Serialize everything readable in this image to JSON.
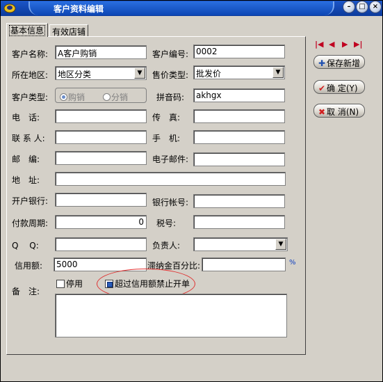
{
  "window": {
    "title": "客户资料编辑",
    "controls": {
      "minimize": "–",
      "maximize": "□",
      "close": "×"
    }
  },
  "tabs": [
    {
      "label": "基本信息",
      "active": true
    },
    {
      "label": "有效店铺",
      "active": false
    }
  ],
  "form": {
    "customer_name": {
      "label": "客户名称:",
      "value": "A客户购销"
    },
    "customer_code": {
      "label": "客户编号:",
      "value": "0002"
    },
    "region": {
      "label": "所在地区:",
      "value": "地区分类"
    },
    "price_type": {
      "label": "售价类型:",
      "value": "批发价"
    },
    "customer_type": {
      "label": "客户类型:",
      "options": [
        {
          "label": "购销",
          "selected": true
        },
        {
          "label": "分销",
          "selected": false
        }
      ]
    },
    "pinyin": {
      "label": "拼音码:",
      "value": "akhgx"
    },
    "phone": {
      "label": "电　话:",
      "value": ""
    },
    "fax": {
      "label": "传　真:",
      "value": ""
    },
    "contact": {
      "label": "联 系 人:",
      "value": ""
    },
    "mobile": {
      "label": "手　机:",
      "value": ""
    },
    "postcode": {
      "label": "邮　编:",
      "value": ""
    },
    "email": {
      "label": "电子邮件:",
      "value": ""
    },
    "address": {
      "label": "地　址:",
      "value": ""
    },
    "bank": {
      "label": "开户银行:",
      "value": ""
    },
    "account": {
      "label": "银行帐号:",
      "value": ""
    },
    "payment_days": {
      "label": "付款周期:",
      "value": "0"
    },
    "tax_no": {
      "label": "税号:",
      "value": ""
    },
    "qq": {
      "label": "Q　 Q:",
      "value": ""
    },
    "manager": {
      "label": "负责人:",
      "value": ""
    },
    "credit": {
      "label": "信用额:",
      "value": "5000"
    },
    "deposit_pct": {
      "label": "滞纳金百分比:",
      "value": "",
      "unit": "%"
    },
    "disabled": {
      "label": "停用",
      "checked": false
    },
    "over_credit_block": {
      "label": "超过信用额禁止开单",
      "checked": true
    },
    "remark": {
      "label": "备　注:",
      "value": ""
    }
  },
  "side_buttons": {
    "save_new": "保存新增",
    "confirm": "确  定(Y)",
    "cancel": "取  消(N)"
  },
  "nav": {
    "first": "|◀",
    "prev": "◀",
    "next": "▶",
    "last": "▶|"
  }
}
